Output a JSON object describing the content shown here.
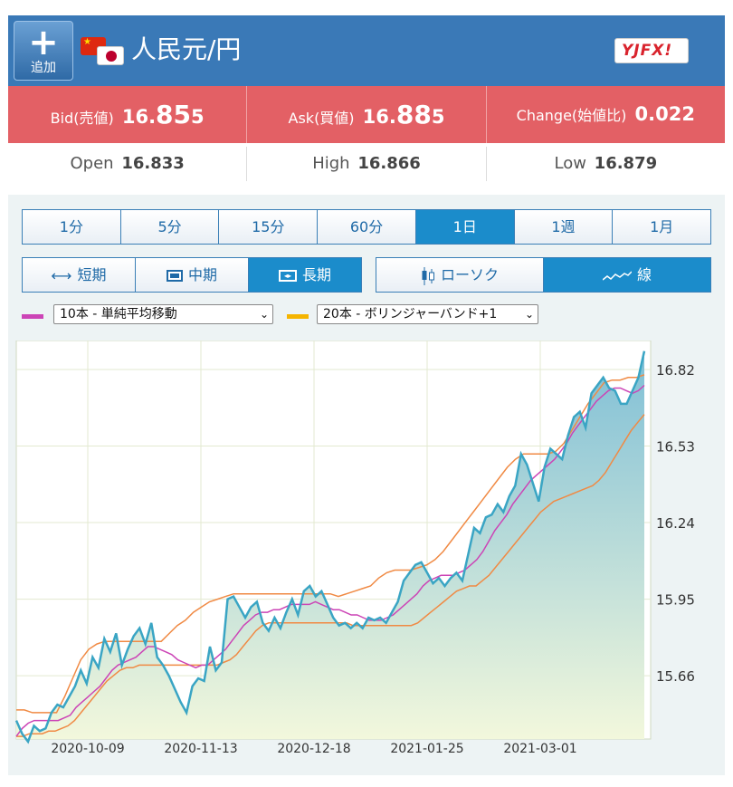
{
  "header": {
    "add_button_label": "追加",
    "pair_title": "人民元/円",
    "logo_text": "YJFX!"
  },
  "quotes": {
    "bid_label": "Bid(売値)",
    "bid_prefix": "16.",
    "bid_big": "85",
    "bid_suffix": "5",
    "ask_label": "Ask(買値)",
    "ask_prefix": "16.",
    "ask_big": "88",
    "ask_suffix": "5",
    "change_label": "Change(始値比)",
    "change_value": "0.022"
  },
  "ohl": {
    "open_label": "Open",
    "open_value": "16.833",
    "high_label": "High",
    "high_value": "16.866",
    "low_label": "Low",
    "low_value": "16.879"
  },
  "periods": [
    "1分",
    "5分",
    "15分",
    "60分",
    "1日",
    "1週",
    "1月"
  ],
  "active_period_index": 4,
  "ranges": [
    "短期",
    "中期",
    "長期"
  ],
  "active_range_index": 2,
  "chart_types": [
    "ローソク",
    "線"
  ],
  "active_chart_type_index": 1,
  "indicators": {
    "sma": {
      "label": "10本 - 単純平均移動",
      "color": "#cc44b6"
    },
    "bollinger": {
      "label": "20本 - ボリンジャーバンド+1",
      "color": "#f5b400"
    }
  },
  "colors": {
    "header_bg": "#3a79b7",
    "quote_bg": "#e36065",
    "active_btn": "#1b8ccb",
    "price_line": "#3aa5c4",
    "sma_line": "#cc44b6",
    "band_line": "#f08a44"
  },
  "chart_data": {
    "type": "line",
    "x_tick_labels": [
      "2020-10-09",
      "2020-11-13",
      "2020-12-18",
      "2021-01-25",
      "2021-03-01"
    ],
    "y_tick_labels": [
      "16.82",
      "16.53",
      "16.24",
      "15.95",
      "15.66"
    ],
    "ylim": [
      15.42,
      16.93
    ],
    "grid": true,
    "series": [
      {
        "values": [
          15.49,
          15.44,
          15.41,
          15.47,
          15.45,
          15.46,
          15.52,
          15.55,
          15.54,
          15.58,
          15.62,
          15.68,
          15.63,
          15.73,
          15.69,
          15.8,
          15.75,
          15.82,
          15.7,
          15.76,
          15.81,
          15.84,
          15.78,
          15.86,
          15.73,
          15.7,
          15.66,
          15.61,
          15.56,
          15.52,
          15.62,
          15.65,
          15.64,
          15.77,
          15.68,
          15.71,
          15.95,
          15.96,
          15.92,
          15.88,
          15.92,
          15.94,
          15.86,
          15.83,
          15.88,
          15.84,
          15.9,
          15.95,
          15.89,
          15.98,
          16.0,
          15.96,
          15.98,
          15.93,
          15.88,
          15.85,
          15.86,
          15.84,
          15.86,
          15.84,
          15.88,
          15.87,
          15.88,
          15.86,
          15.9,
          15.94,
          16.02,
          16.05,
          16.08,
          16.09,
          16.05,
          16.01,
          16.03,
          16.0,
          16.03,
          16.05,
          16.02,
          16.12,
          16.22,
          16.2,
          16.26,
          16.27,
          16.31,
          16.28,
          16.34,
          16.38,
          16.5,
          16.46,
          16.39,
          16.32,
          16.45,
          16.52,
          16.5,
          16.48,
          16.57,
          16.64,
          16.66,
          16.6,
          16.73,
          16.76,
          16.79,
          16.75,
          16.74,
          16.69,
          16.69,
          16.74,
          16.79,
          16.89
        ]
      },
      {
        "values": [
          15.43,
          15.46,
          15.48,
          15.49,
          15.49,
          15.49,
          15.49,
          15.49,
          15.5,
          15.51,
          15.54,
          15.56,
          15.58,
          15.6,
          15.62,
          15.65,
          15.68,
          15.7,
          15.71,
          15.72,
          15.73,
          15.75,
          15.77,
          15.77,
          15.76,
          15.75,
          15.74,
          15.72,
          15.71,
          15.7,
          15.69,
          15.7,
          15.7,
          15.72,
          15.74,
          15.76,
          15.79,
          15.82,
          15.85,
          15.87,
          15.89,
          15.9,
          15.9,
          15.91,
          15.91,
          15.92,
          15.93,
          15.93,
          15.93,
          15.93,
          15.94,
          15.93,
          15.92,
          15.91,
          15.91,
          15.9,
          15.89,
          15.89,
          15.88,
          15.87,
          15.87,
          15.87,
          15.88,
          15.89,
          15.91,
          15.93,
          15.95,
          15.97,
          16.0,
          16.02,
          16.03,
          16.04,
          16.04,
          16.04,
          16.05,
          16.06,
          16.08,
          16.1,
          16.13,
          16.17,
          16.21,
          16.24,
          16.27,
          16.31,
          16.34,
          16.37,
          16.4,
          16.42,
          16.44,
          16.46,
          16.48,
          16.51,
          16.54,
          16.58,
          16.61,
          16.64,
          16.67,
          16.7,
          16.72,
          16.74,
          16.75,
          16.75,
          16.74,
          16.73,
          16.74,
          16.76
        ]
      },
      {
        "values": [
          15.43,
          15.43,
          15.44,
          15.44,
          15.44,
          15.45,
          15.45,
          15.46,
          15.47,
          15.49,
          15.52,
          15.55,
          15.58,
          15.61,
          15.64,
          15.66,
          15.68,
          15.69,
          15.69,
          15.7,
          15.7,
          15.7,
          15.7,
          15.7,
          15.7,
          15.7,
          15.7,
          15.7,
          15.7,
          15.7,
          15.7,
          15.7,
          15.71,
          15.72,
          15.74,
          15.77,
          15.8,
          15.83,
          15.85,
          15.86,
          15.86,
          15.86,
          15.86,
          15.86,
          15.86,
          15.86,
          15.86,
          15.86,
          15.86,
          15.86,
          15.86,
          15.86,
          15.85,
          15.85,
          15.85,
          15.85,
          15.85,
          15.85,
          15.85,
          15.85,
          15.85,
          15.85,
          15.86,
          15.88,
          15.9,
          15.92,
          15.94,
          15.96,
          15.98,
          15.99,
          16.0,
          16.0,
          16.02,
          16.04,
          16.07,
          16.1,
          16.13,
          16.16,
          16.19,
          16.22,
          16.25,
          16.28,
          16.3,
          16.32,
          16.33,
          16.34,
          16.35,
          16.36,
          16.37,
          16.38,
          16.4,
          16.43,
          16.47,
          16.51,
          16.55,
          16.59,
          16.62,
          16.65
        ]
      },
      {
        "values": [
          15.53,
          15.53,
          15.52,
          15.52,
          15.52,
          15.52,
          15.58,
          15.65,
          15.72,
          15.76,
          15.78,
          15.79,
          15.79,
          15.79,
          15.79,
          15.79,
          15.79,
          15.79,
          15.79,
          15.82,
          15.85,
          15.87,
          15.9,
          15.92,
          15.94,
          15.95,
          15.96,
          15.97,
          15.97,
          15.97,
          15.97,
          15.97,
          15.97,
          15.97,
          15.97,
          15.97,
          15.97,
          15.97,
          15.97,
          15.97,
          15.96,
          15.97,
          15.98,
          15.99,
          16.0,
          16.03,
          16.05,
          16.06,
          16.06,
          16.06,
          16.07,
          16.08,
          16.1,
          16.13,
          16.17,
          16.21,
          16.25,
          16.29,
          16.33,
          16.37,
          16.41,
          16.45,
          16.48,
          16.5,
          16.5,
          16.5,
          16.5,
          16.51,
          16.54,
          16.59,
          16.64,
          16.69,
          16.73,
          16.77,
          16.78,
          16.78,
          16.79,
          16.79,
          16.8
        ]
      }
    ]
  }
}
